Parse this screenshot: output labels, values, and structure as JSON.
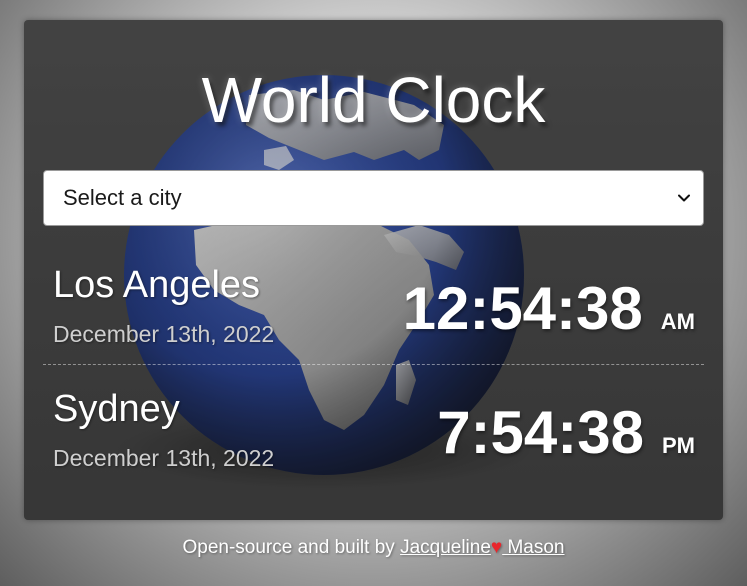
{
  "app": {
    "title": "World Clock"
  },
  "select": {
    "value": "Select a city"
  },
  "cities": [
    {
      "name": "Los Angeles",
      "date": "December 13th, 2022",
      "time": "12:54:38",
      "ampm": "AM"
    },
    {
      "name": "Sydney",
      "date": "December 13th, 2022",
      "time": "7:54:38",
      "ampm": "PM"
    }
  ],
  "footer": {
    "prefix": "Open-source and built by ",
    "author_first": "Jacqueline",
    "author_last": " Mason"
  },
  "icons": {
    "select_arrow": "chevron-down-icon",
    "heart": "heart-icon",
    "background": "globe-icon"
  },
  "colors": {
    "card": "#3e3e3e",
    "globe_ocean": "#1f3c8f",
    "heart": "#e8262c",
    "date_text": "#cfcfcf"
  }
}
